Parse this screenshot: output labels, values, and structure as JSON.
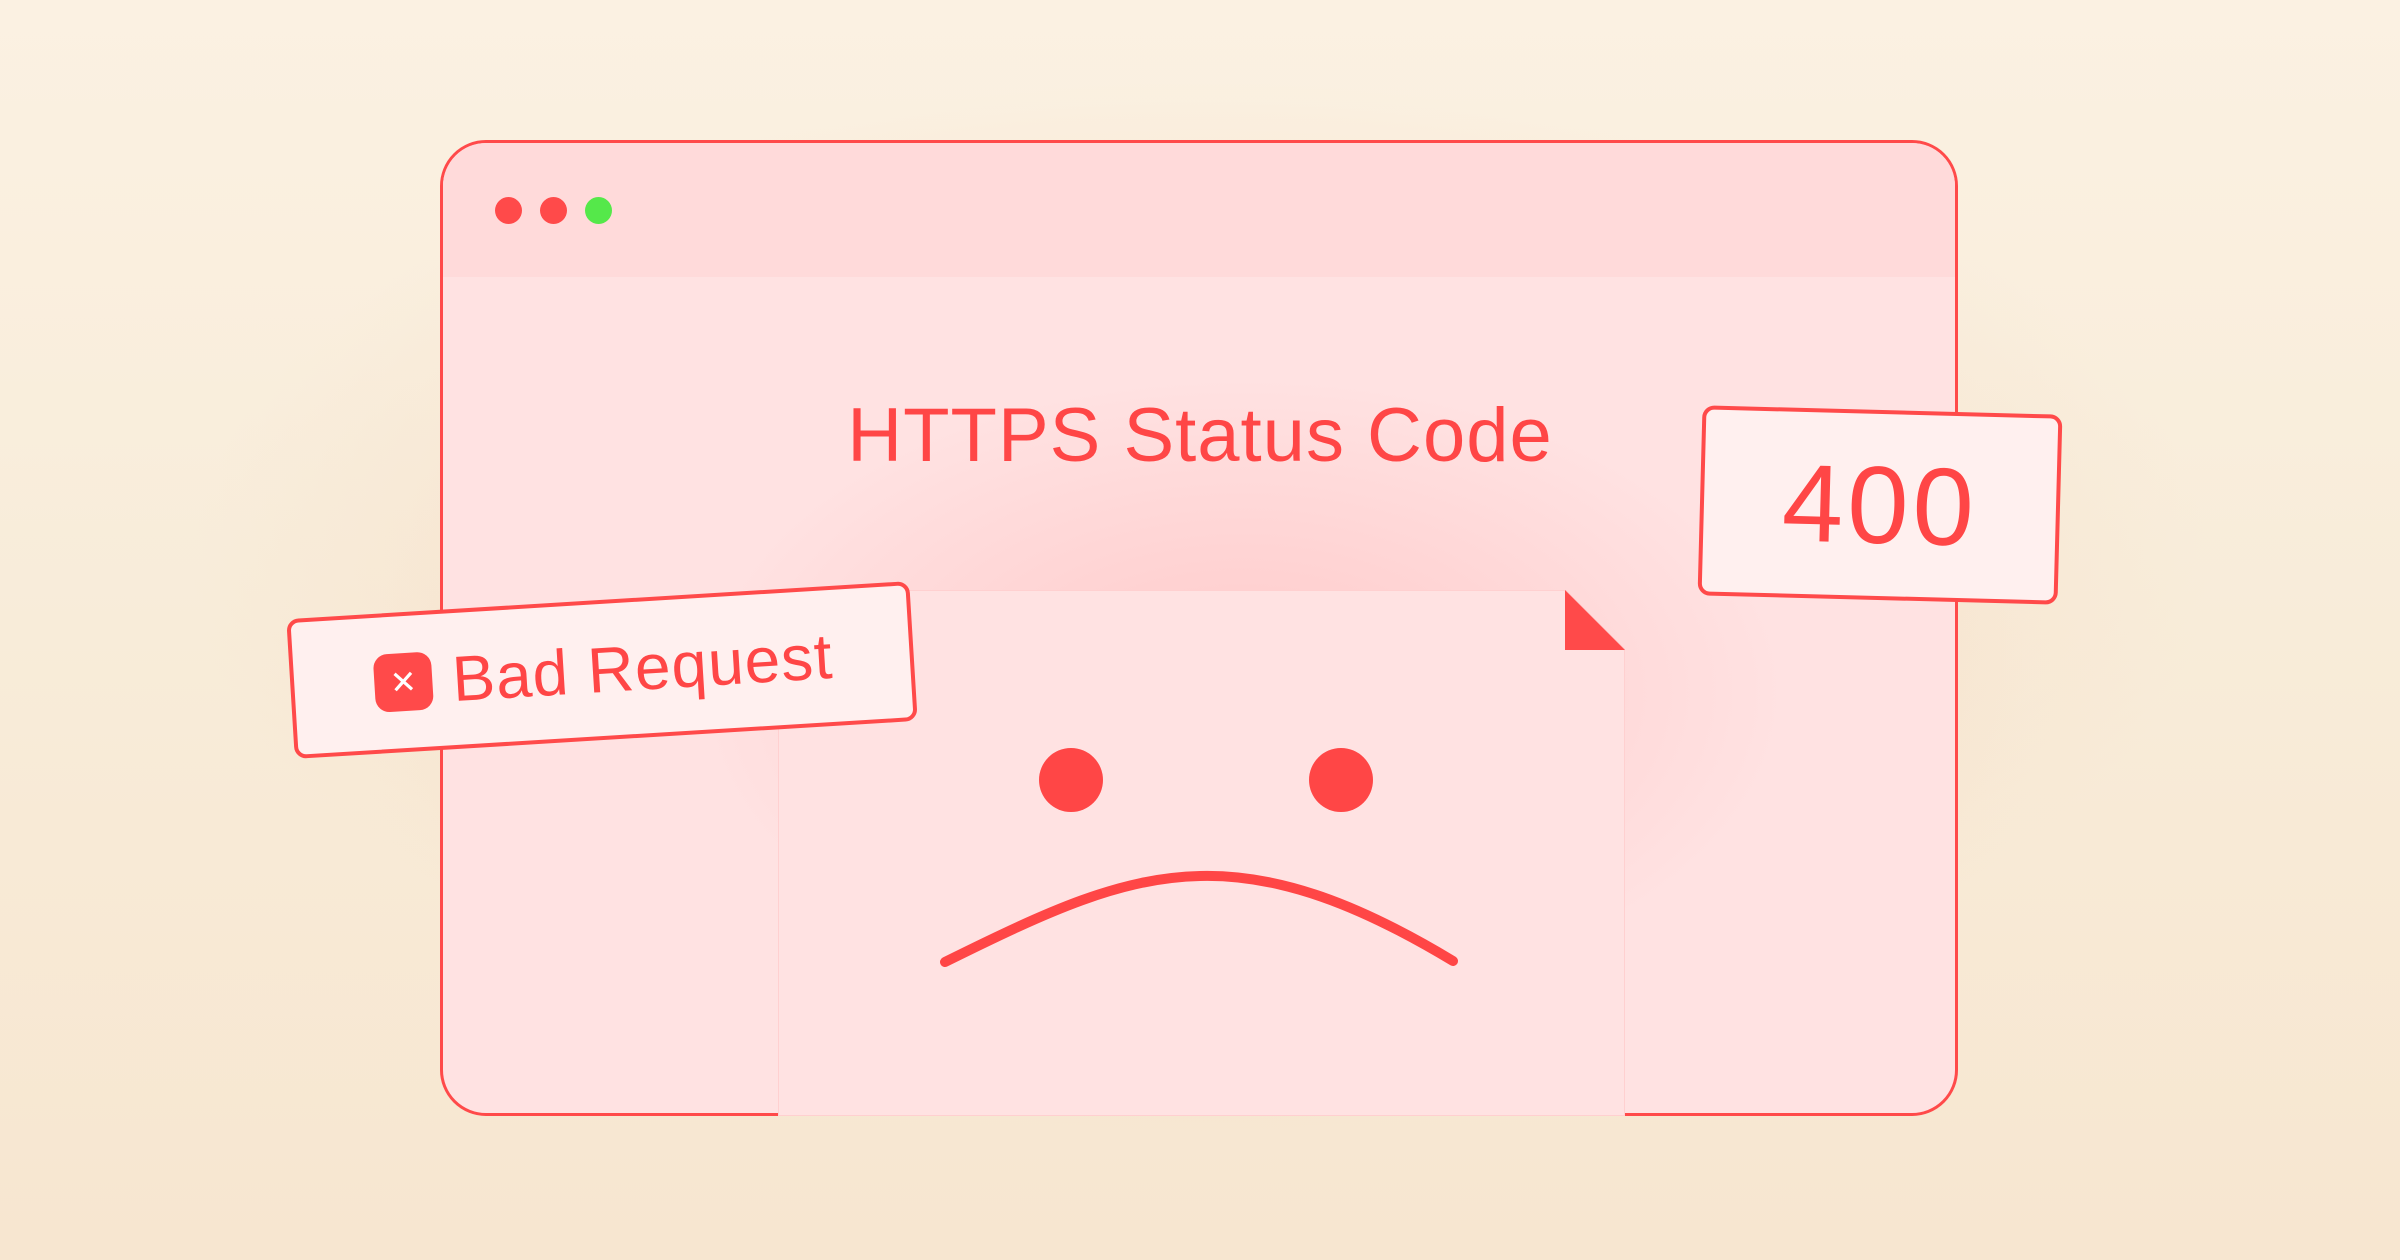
{
  "title": "HTTPS Status Code",
  "status_code": "400",
  "status_label": "Bad Request",
  "status_icon": "close-icon",
  "window_controls": [
    {
      "name": "close-dot",
      "color": "#ff4a4a"
    },
    {
      "name": "minimize-dot",
      "color": "#ff4a4a"
    },
    {
      "name": "maximize-dot",
      "color": "#55e84a"
    }
  ],
  "colors": {
    "accent": "#ff4a4a",
    "window_bg": "#ffe2e2",
    "card_bg": "#fff0ef"
  },
  "illustration": "sad-face-document"
}
